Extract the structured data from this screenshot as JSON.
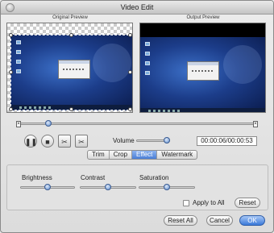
{
  "window": {
    "title": "Video Edit"
  },
  "previews": {
    "original_label": "Original Preview",
    "output_label": "Output Preview"
  },
  "scrubber": {
    "start_marker": "×",
    "end_marker": "×",
    "position_fraction": 0.12
  },
  "playback": {
    "play_pause_icon": "pause-icon",
    "stop_icon": "stop-icon",
    "mark_in_icon": "trim-start-icon",
    "mark_out_icon": "trim-end-icon",
    "volume_label": "Volume",
    "volume_level": 0.9,
    "timecode": "00:00:06/00:00:53"
  },
  "tabs": [
    {
      "label": "Trim",
      "active": false
    },
    {
      "label": "Crop",
      "active": false
    },
    {
      "label": "Effect",
      "active": true
    },
    {
      "label": "Watermark",
      "active": false
    }
  ],
  "effect": {
    "brightness_label": "Brightness",
    "brightness_level": 0.5,
    "contrast_label": "Contrast",
    "contrast_level": 0.5,
    "saturation_label": "Saturation",
    "saturation_level": 0.5,
    "apply_to_all_label": "Apply to All",
    "apply_to_all_checked": false,
    "reset_label": "Reset"
  },
  "footer": {
    "reset_all_label": "Reset All",
    "cancel_label": "Cancel",
    "ok_label": "OK"
  },
  "colors": {
    "accent": "#3a79d9",
    "preview_bg": "#000000"
  }
}
